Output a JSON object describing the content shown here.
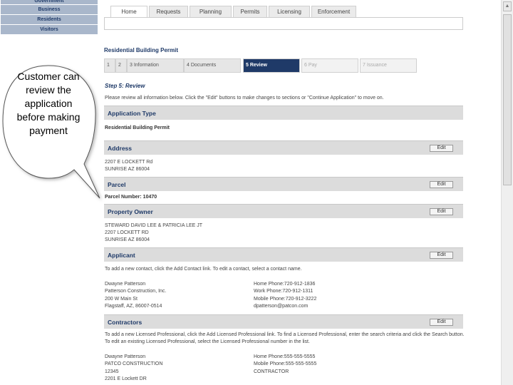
{
  "sidebar": {
    "items": [
      {
        "label": "Government"
      },
      {
        "label": "Business"
      },
      {
        "label": "Residents"
      },
      {
        "label": "Visitors"
      }
    ]
  },
  "callout": {
    "text": "Customer can review the application before making payment"
  },
  "tabs": [
    {
      "label": "Home"
    },
    {
      "label": "Requests"
    },
    {
      "label": "Planning"
    },
    {
      "label": "Permits"
    },
    {
      "label": "Licensing"
    },
    {
      "label": "Enforcement"
    }
  ],
  "permit_title": "Residential Building Permit",
  "steps": [
    {
      "label": "1"
    },
    {
      "label": "2"
    },
    {
      "label": "3  Information"
    },
    {
      "label": "4  Documents"
    },
    {
      "label": "5  Review"
    },
    {
      "label": "6  Pay"
    },
    {
      "label": "7  Issuance"
    }
  ],
  "step_title": "Step 5: Review",
  "instruction": "Please review all information below. Click the \"Edit\" buttons to make changes to sections or \"Continue Application\" to move on.",
  "edit_label": "Edit",
  "sections": {
    "application_type": {
      "title": "Application Type",
      "value": "Residential Building Permit"
    },
    "address": {
      "title": "Address",
      "lines": [
        "2207 E LOCKETT Rd",
        "SUNRISE AZ 86004"
      ]
    },
    "parcel": {
      "title": "Parcel",
      "value": "Parcel Number: 10470"
    },
    "property_owner": {
      "title": "Property Owner",
      "lines": [
        "STEWARD DAVID LEE & PATRICIA LEE JT",
        "2207 LOCKETT RD",
        "SUNRISE AZ 86004"
      ]
    },
    "applicant": {
      "title": "Applicant",
      "instruction": "To add a new contact, click the Add Contact link. To edit a contact, select a contact name.",
      "left_lines": [
        "Dwayne Patterson",
        "Patterson Construction, Inc.",
        "200 W Main St",
        "Flagstaff, AZ, 86007-0514"
      ],
      "right_lines": [
        "Home Phone:720-912-1836",
        "Work Phone:720-912-1311",
        "Mobile Phone:720-912-3222",
        "dpatterson@patcon.com"
      ]
    },
    "contractors": {
      "title": "Contractors",
      "instruction_1": "To add a new Licensed Professional, click the Add Licensed Professional link. To find a Licensed Professional, enter the search criteria and click the Search button.",
      "instruction_2": "To edit an existing Licensed Professional, select the Licensed Professional number in the list.",
      "left_lines": [
        "Dwayne Patterson",
        "PATCO CONSTRUCTION",
        "12345",
        "2201 E Lockett DR"
      ],
      "right_lines": [
        "Home Phone:555-555-5555",
        "Mobile Phone:555-555-5555",
        "CONTRACTOR"
      ]
    }
  }
}
